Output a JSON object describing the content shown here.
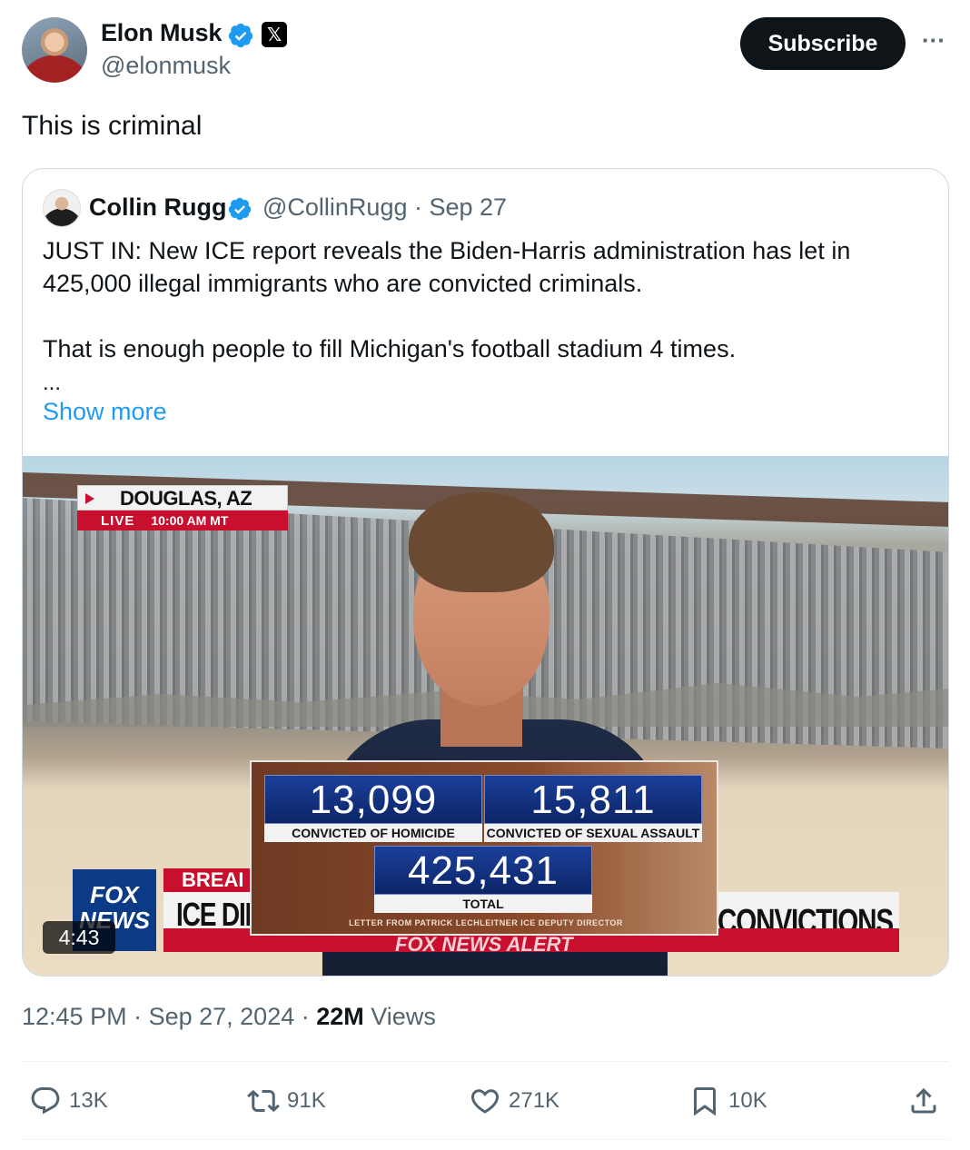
{
  "author": {
    "name": "Elon Musk",
    "handle": "@elonmusk",
    "badge": "𝕏"
  },
  "header": {
    "subscribe_label": "Subscribe",
    "more_label": "···"
  },
  "tweet": {
    "text": "This is criminal"
  },
  "quote": {
    "author_name": "Collin Rugg",
    "meta": "@CollinRugg · Sep 27",
    "line1": "JUST IN: New ICE report reveals the Biden-Harris administration has let in 425,000 illegal immigrants who are convicted criminals.",
    "line2": "That is enough people to fill Michigan's football stadium 4 times.",
    "ellipsis": "...",
    "show_more": "Show more"
  },
  "video": {
    "location": "DOUGLAS, AZ",
    "live": "LIVE",
    "time": "10:00 AM MT",
    "breaking": "BREAI",
    "lower_left": "ICE DII",
    "lower_right": "CONVICTIONS",
    "logo": "FOX NEWS",
    "stats": [
      {
        "value": "13,099",
        "label": "CONVICTED OF HOMICIDE"
      },
      {
        "value": "15,811",
        "label": "CONVICTED OF SEXUAL ASSAULT"
      },
      {
        "value": "425,431",
        "label": "TOTAL"
      }
    ],
    "letter": "LETTER FROM PATRICK LECHLEITNER ICE DEPUTY DIRECTOR",
    "alert": "FOX NEWS ALERT",
    "duration": "4:43"
  },
  "footer": {
    "time": "12:45 PM",
    "date": "Sep 27, 2024",
    "views_count": "22M",
    "views_label": "Views"
  },
  "actions": {
    "replies": "13K",
    "reposts": "91K",
    "likes": "271K",
    "bookmarks": "10K"
  },
  "colors": {
    "verified": "#1d9bf0",
    "link": "#1d9bf0",
    "fox_red": "#c8102e",
    "fox_blue": "#0b3a86"
  }
}
